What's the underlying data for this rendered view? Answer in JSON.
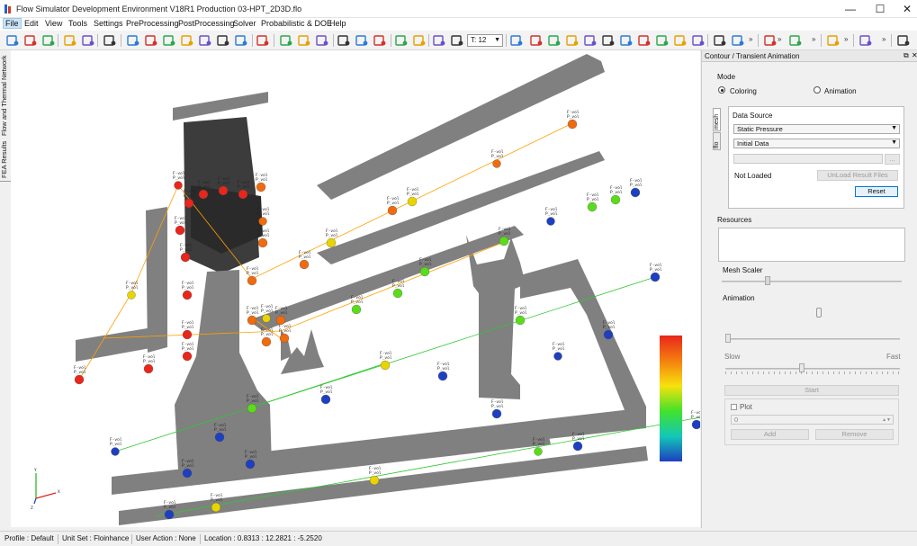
{
  "window": {
    "title": "Flow Simulator Development Environment V18R1 Production 03-HPT_2D3D.flo",
    "minimize": "—",
    "maximize": "☐",
    "close": "✕"
  },
  "menu": {
    "items": [
      "File",
      "Edit",
      "View",
      "Tools",
      "Settings",
      "PreProcessing",
      "PostProcessing",
      "Solver",
      "Probabilistic & DOE",
      "Help"
    ]
  },
  "toolbar": {
    "font_size_value": "T: 12",
    "more": "»",
    "icons": [
      "new-model-icon",
      "open-model-icon",
      "save-icon",
      "import-icon",
      "export-icon",
      "user-icon",
      "axis-x-icon",
      "axis-y-icon",
      "axis-z-icon",
      "axis-neg-x-icon",
      "axis-neg-y-icon",
      "axis-neg-z-icon",
      "axis-iso-icon",
      "monitor-icon",
      "fit-all-icon",
      "fit-selection-icon",
      "fit-window-icon",
      "zoom-in-icon",
      "zoom-out-icon",
      "zoom-box-icon",
      "pan-hand-icon",
      "rotate-icon",
      "font-larger-icon",
      "font-smaller-icon",
      "line-tool-icon",
      "bar-chart-icon",
      "histogram-icon",
      "cube-icon",
      "add-element-icon",
      "measure-icon",
      "layers-icon",
      "lasso-icon",
      "sigma-icon",
      "airplane-icon",
      "tools-icon",
      "palette-icon",
      "trend-icon",
      "check-icon",
      "graph-icon",
      "connect-icon",
      "mouse-icon",
      "eye-icon"
    ]
  },
  "sidebar": {
    "tabs": [
      "Flow and Thermal Network",
      "FEA Results"
    ]
  },
  "viewport": {
    "node_label": "F-vol",
    "node_sub": "P_vol",
    "axis_labels": [
      "Y",
      "Z",
      "X"
    ],
    "colors": {
      "structure": "#808080",
      "structure_dark": "#3c3c3c",
      "link_orange": "#ffa000",
      "link_green": "#2ec82e",
      "node_red": "#e8261b",
      "node_orange": "#f06a0f",
      "node_yellow": "#e8d400",
      "node_green": "#5bdc1a",
      "node_blue": "#1e3fc0"
    },
    "legend_gradient": [
      "#e8261b",
      "#f57f10",
      "#f6e20c",
      "#42e22a",
      "#12c8b8",
      "#1e3fc0"
    ]
  },
  "panel": {
    "title": "Contour / Transient Animation",
    "mode_label": "Mode",
    "coloring_label": "Coloring",
    "animation_label": "Animation",
    "side_tabs": [
      "mesh",
      "flo"
    ],
    "data_source_label": "Data Source",
    "data_source_value": "Static Pressure",
    "data_set_value": "Initial Data",
    "file_path_value": "",
    "browse_label": "...",
    "status_value": "Not Loaded",
    "unload_label": "UnLoad Result Files",
    "reset_label": "Reset",
    "resources_label": "Resources",
    "mesh_scaler_label": "Mesh Scaler",
    "animation_section_label": "Animation",
    "slow_label": "Slow",
    "fast_label": "Fast",
    "start_label": "Start",
    "plot_label": "Plot",
    "plot_value": "0",
    "add_label": "Add",
    "remove_label": "Remove"
  },
  "statusbar": {
    "profile": "Profile :  Default",
    "unit_set": "Unit Set :  Floinhance",
    "user_action": "User Action :  None",
    "location": "Location :  0.8313  :  12.2821  :  -5.2520"
  }
}
